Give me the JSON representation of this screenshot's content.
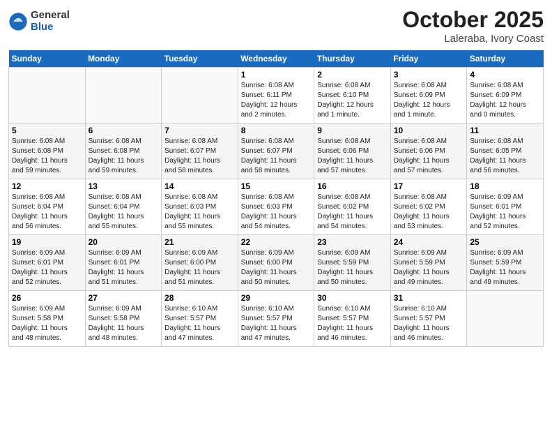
{
  "header": {
    "logo_general": "General",
    "logo_blue": "Blue",
    "month": "October 2025",
    "location": "Laleraba, Ivory Coast"
  },
  "weekdays": [
    "Sunday",
    "Monday",
    "Tuesday",
    "Wednesday",
    "Thursday",
    "Friday",
    "Saturday"
  ],
  "weeks": [
    [
      {
        "day": "",
        "info": ""
      },
      {
        "day": "",
        "info": ""
      },
      {
        "day": "",
        "info": ""
      },
      {
        "day": "1",
        "info": "Sunrise: 6:08 AM\nSunset: 6:11 PM\nDaylight: 12 hours\nand 2 minutes."
      },
      {
        "day": "2",
        "info": "Sunrise: 6:08 AM\nSunset: 6:10 PM\nDaylight: 12 hours\nand 1 minute."
      },
      {
        "day": "3",
        "info": "Sunrise: 6:08 AM\nSunset: 6:09 PM\nDaylight: 12 hours\nand 1 minute."
      },
      {
        "day": "4",
        "info": "Sunrise: 6:08 AM\nSunset: 6:09 PM\nDaylight: 12 hours\nand 0 minutes."
      }
    ],
    [
      {
        "day": "5",
        "info": "Sunrise: 6:08 AM\nSunset: 6:08 PM\nDaylight: 11 hours\nand 59 minutes."
      },
      {
        "day": "6",
        "info": "Sunrise: 6:08 AM\nSunset: 6:08 PM\nDaylight: 11 hours\nand 59 minutes."
      },
      {
        "day": "7",
        "info": "Sunrise: 6:08 AM\nSunset: 6:07 PM\nDaylight: 11 hours\nand 58 minutes."
      },
      {
        "day": "8",
        "info": "Sunrise: 6:08 AM\nSunset: 6:07 PM\nDaylight: 11 hours\nand 58 minutes."
      },
      {
        "day": "9",
        "info": "Sunrise: 6:08 AM\nSunset: 6:06 PM\nDaylight: 11 hours\nand 57 minutes."
      },
      {
        "day": "10",
        "info": "Sunrise: 6:08 AM\nSunset: 6:06 PM\nDaylight: 11 hours\nand 57 minutes."
      },
      {
        "day": "11",
        "info": "Sunrise: 6:08 AM\nSunset: 6:05 PM\nDaylight: 11 hours\nand 56 minutes."
      }
    ],
    [
      {
        "day": "12",
        "info": "Sunrise: 6:08 AM\nSunset: 6:04 PM\nDaylight: 11 hours\nand 56 minutes."
      },
      {
        "day": "13",
        "info": "Sunrise: 6:08 AM\nSunset: 6:04 PM\nDaylight: 11 hours\nand 55 minutes."
      },
      {
        "day": "14",
        "info": "Sunrise: 6:08 AM\nSunset: 6:03 PM\nDaylight: 11 hours\nand 55 minutes."
      },
      {
        "day": "15",
        "info": "Sunrise: 6:08 AM\nSunset: 6:03 PM\nDaylight: 11 hours\nand 54 minutes."
      },
      {
        "day": "16",
        "info": "Sunrise: 6:08 AM\nSunset: 6:02 PM\nDaylight: 11 hours\nand 54 minutes."
      },
      {
        "day": "17",
        "info": "Sunrise: 6:08 AM\nSunset: 6:02 PM\nDaylight: 11 hours\nand 53 minutes."
      },
      {
        "day": "18",
        "info": "Sunrise: 6:09 AM\nSunset: 6:01 PM\nDaylight: 11 hours\nand 52 minutes."
      }
    ],
    [
      {
        "day": "19",
        "info": "Sunrise: 6:09 AM\nSunset: 6:01 PM\nDaylight: 11 hours\nand 52 minutes."
      },
      {
        "day": "20",
        "info": "Sunrise: 6:09 AM\nSunset: 6:01 PM\nDaylight: 11 hours\nand 51 minutes."
      },
      {
        "day": "21",
        "info": "Sunrise: 6:09 AM\nSunset: 6:00 PM\nDaylight: 11 hours\nand 51 minutes."
      },
      {
        "day": "22",
        "info": "Sunrise: 6:09 AM\nSunset: 6:00 PM\nDaylight: 11 hours\nand 50 minutes."
      },
      {
        "day": "23",
        "info": "Sunrise: 6:09 AM\nSunset: 5:59 PM\nDaylight: 11 hours\nand 50 minutes."
      },
      {
        "day": "24",
        "info": "Sunrise: 6:09 AM\nSunset: 5:59 PM\nDaylight: 11 hours\nand 49 minutes."
      },
      {
        "day": "25",
        "info": "Sunrise: 6:09 AM\nSunset: 5:59 PM\nDaylight: 11 hours\nand 49 minutes."
      }
    ],
    [
      {
        "day": "26",
        "info": "Sunrise: 6:09 AM\nSunset: 5:58 PM\nDaylight: 11 hours\nand 48 minutes."
      },
      {
        "day": "27",
        "info": "Sunrise: 6:09 AM\nSunset: 5:58 PM\nDaylight: 11 hours\nand 48 minutes."
      },
      {
        "day": "28",
        "info": "Sunrise: 6:10 AM\nSunset: 5:57 PM\nDaylight: 11 hours\nand 47 minutes."
      },
      {
        "day": "29",
        "info": "Sunrise: 6:10 AM\nSunset: 5:57 PM\nDaylight: 11 hours\nand 47 minutes."
      },
      {
        "day": "30",
        "info": "Sunrise: 6:10 AM\nSunset: 5:57 PM\nDaylight: 11 hours\nand 46 minutes."
      },
      {
        "day": "31",
        "info": "Sunrise: 6:10 AM\nSunset: 5:57 PM\nDaylight: 11 hours\nand 46 minutes."
      },
      {
        "day": "",
        "info": ""
      }
    ]
  ]
}
